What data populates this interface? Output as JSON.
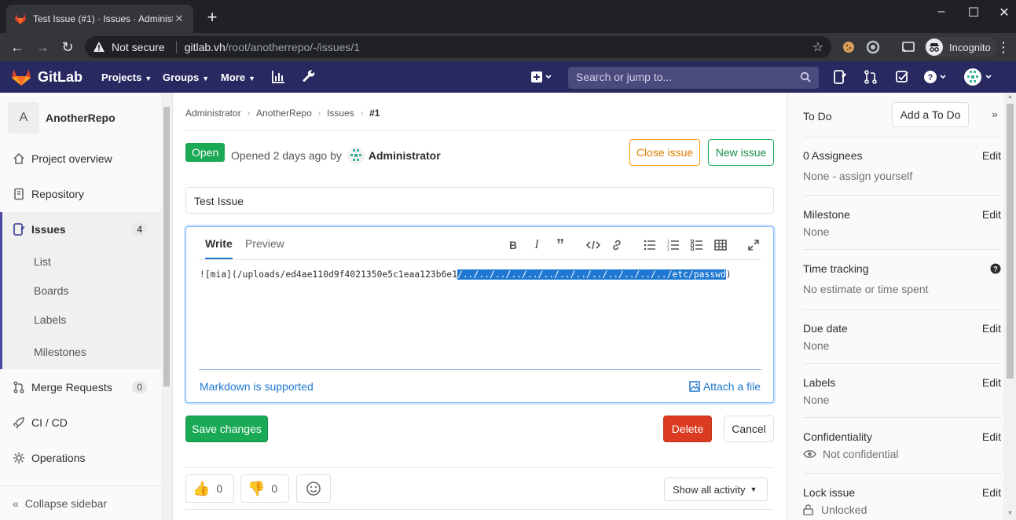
{
  "browser": {
    "tab_title": "Test Issue (#1) · Issues · Administr",
    "security_label": "Not secure",
    "url_host": "gitlab.vh",
    "url_path": "/root/anotherrepo/-/issues/1",
    "profile_label": "Incognito"
  },
  "navbar": {
    "brand": "GitLab",
    "menus": [
      "Projects",
      "Groups",
      "More"
    ],
    "search_placeholder": "Search or jump to..."
  },
  "sidebar": {
    "project_initial": "A",
    "project_name": "AnotherRepo",
    "items": [
      {
        "label": "Project overview",
        "icon": "home-icon"
      },
      {
        "label": "Repository",
        "icon": "book-icon"
      },
      {
        "label": "Issues",
        "icon": "issues-icon",
        "count": "4"
      },
      {
        "label": "Merge Requests",
        "icon": "merge-request-icon",
        "count": "0"
      },
      {
        "label": "CI / CD",
        "icon": "rocket-icon"
      },
      {
        "label": "Operations",
        "icon": "cloud-gear-icon"
      }
    ],
    "issues_sub": [
      "List",
      "Boards",
      "Labels",
      "Milestones"
    ],
    "collapse_label": "Collapse sidebar"
  },
  "breadcrumb": [
    "Administrator",
    "AnotherRepo",
    "Issues",
    "#1"
  ],
  "issue": {
    "status": "Open",
    "opened_text": "Opened 2 days ago by",
    "author": "Administrator",
    "close_label": "Close issue",
    "new_label": "New issue",
    "title_value": "Test Issue"
  },
  "editor": {
    "tab_write": "Write",
    "tab_preview": "Preview",
    "text_before": "![mia](/uploads/ed4ae110d9f4021350e5c1eaa123b6e1",
    "text_selected": "/../../../../../../../../../../../../../etc/passwd",
    "text_after": ")",
    "markdown_label": "Markdown is supported",
    "attach_label": "Attach a file"
  },
  "actions": {
    "save": "Save changes",
    "delete": "Delete",
    "cancel": "Cancel"
  },
  "reactions": {
    "thumbs_up_count": "0",
    "thumbs_down_count": "0",
    "activity_filter": "Show all activity"
  },
  "right_sidebar": {
    "todo_label": "To Do",
    "add_todo": "Add a To Do",
    "edit_label": "Edit",
    "assignees_label": "0 Assignees",
    "assignees_value": "None - ",
    "assign_yourself": "assign yourself",
    "milestone_label": "Milestone",
    "milestone_value": "None",
    "time_label": "Time tracking",
    "time_value": "No estimate or time spent",
    "due_label": "Due date",
    "due_value": "None",
    "labels_label": "Labels",
    "labels_value": "None",
    "conf_label": "Confidentiality",
    "conf_value": "Not confidential",
    "lock_label": "Lock issue",
    "lock_value": "Unlocked"
  }
}
